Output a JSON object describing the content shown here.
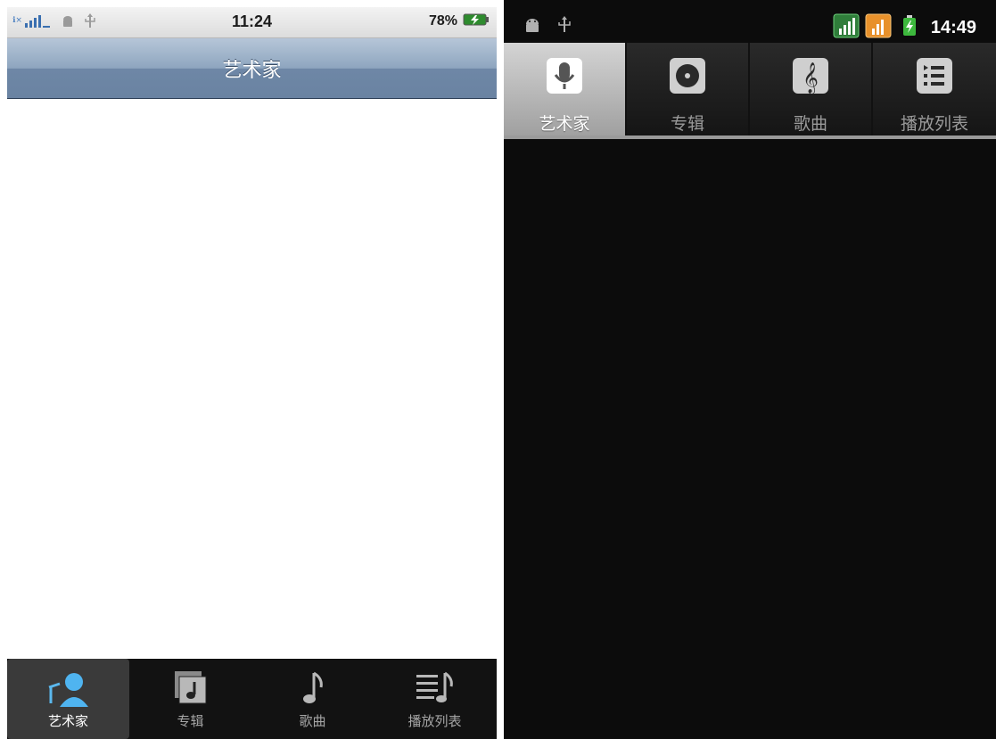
{
  "left_app": {
    "status_bar": {
      "time": "11:24",
      "battery_percent": "78%",
      "icons": [
        "signal-icon",
        "android-icon",
        "usb-icon",
        "battery-charging-icon"
      ]
    },
    "title": "艺术家",
    "tabs": [
      {
        "label": "艺术家",
        "icon": "artist-icon",
        "active": true
      },
      {
        "label": "专辑",
        "icon": "album-icon",
        "active": false
      },
      {
        "label": "歌曲",
        "icon": "music-note-icon",
        "active": false
      },
      {
        "label": "播放列表",
        "icon": "playlist-icon",
        "active": false
      }
    ]
  },
  "right_app": {
    "status_bar": {
      "time": "14:49",
      "icons": [
        "android-icon",
        "usb-icon",
        "signal-green-icon",
        "signal-orange-icon",
        "battery-charging-icon"
      ]
    },
    "tabs": [
      {
        "label": "艺术家",
        "icon": "microphone-icon",
        "active": true
      },
      {
        "label": "专辑",
        "icon": "disc-icon",
        "active": false
      },
      {
        "label": "歌曲",
        "icon": "treble-clef-icon",
        "active": false
      },
      {
        "label": "播放列表",
        "icon": "list-icon",
        "active": false
      }
    ]
  },
  "colors": {
    "ios_nav_top": "#b6c6d8",
    "ios_nav_bottom": "#6a83a2",
    "accent_blue": "#4fb4f0",
    "android_bg": "#0c0c0c"
  }
}
